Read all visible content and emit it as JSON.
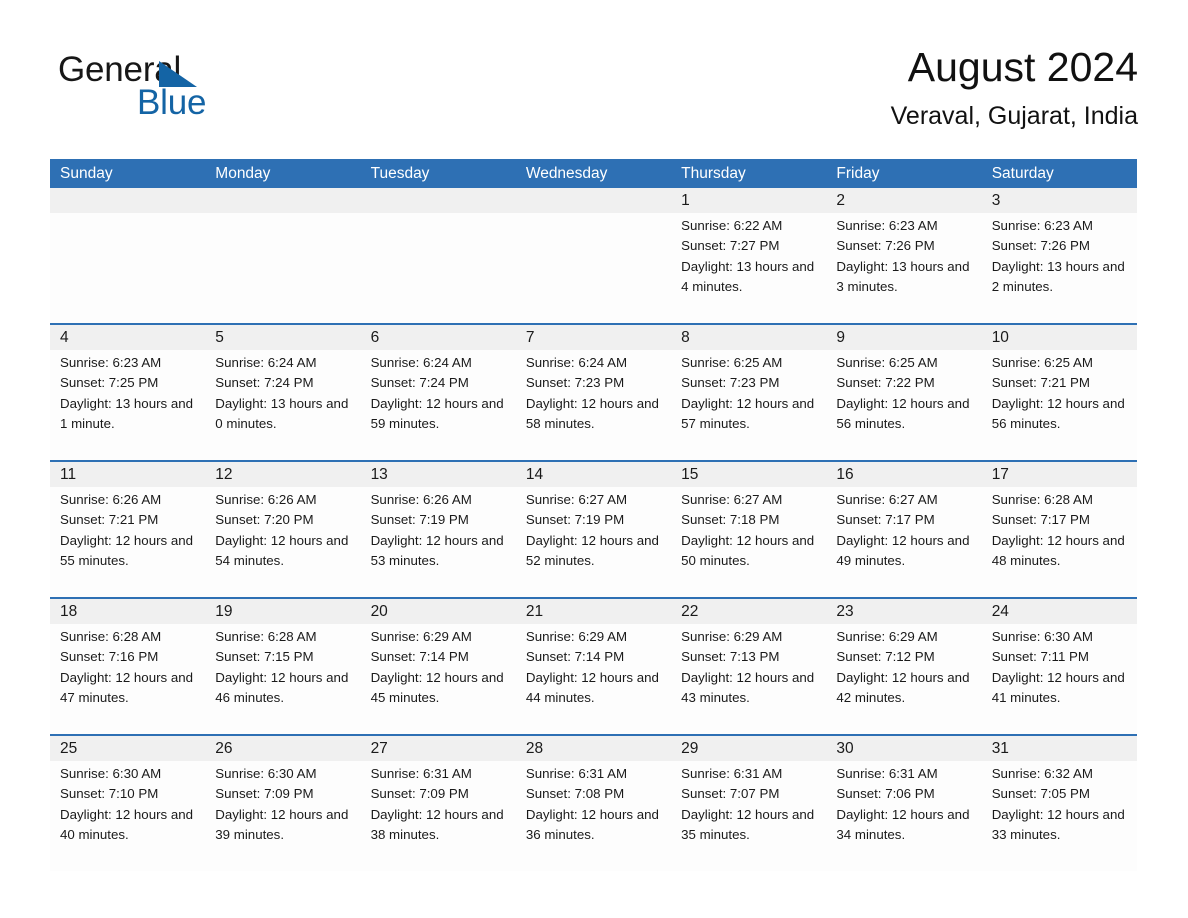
{
  "brand": {
    "name_part1": "General",
    "name_part2": "Blue",
    "accent_color": "#1464a5",
    "triangle_icon": "triangle-icon"
  },
  "header": {
    "title": "August 2024",
    "location": "Veraval, Gujarat, India"
  },
  "theme": {
    "header_blue": "#2e70b4",
    "row_divider_blue": "#2e70b4",
    "day_band_gray": "#f0f0f0",
    "cell_background": "#fdfdfd",
    "text_color": "#1a1a1a"
  },
  "weekdays": [
    "Sunday",
    "Monday",
    "Tuesday",
    "Wednesday",
    "Thursday",
    "Friday",
    "Saturday"
  ],
  "labels": {
    "sunrise_prefix": "Sunrise:",
    "sunset_prefix": "Sunset:",
    "daylight_prefix": "Daylight:"
  },
  "weeks": [
    [
      {
        "day": "",
        "sunrise": "",
        "sunset": "",
        "daylight": "",
        "empty": true
      },
      {
        "day": "",
        "sunrise": "",
        "sunset": "",
        "daylight": "",
        "empty": true
      },
      {
        "day": "",
        "sunrise": "",
        "sunset": "",
        "daylight": "",
        "empty": true
      },
      {
        "day": "",
        "sunrise": "",
        "sunset": "",
        "daylight": "",
        "empty": true
      },
      {
        "day": "1",
        "sunrise": "Sunrise: 6:22 AM",
        "sunset": "Sunset: 7:27 PM",
        "daylight": "Daylight: 13 hours and 4 minutes."
      },
      {
        "day": "2",
        "sunrise": "Sunrise: 6:23 AM",
        "sunset": "Sunset: 7:26 PM",
        "daylight": "Daylight: 13 hours and 3 minutes."
      },
      {
        "day": "3",
        "sunrise": "Sunrise: 6:23 AM",
        "sunset": "Sunset: 7:26 PM",
        "daylight": "Daylight: 13 hours and 2 minutes."
      }
    ],
    [
      {
        "day": "4",
        "sunrise": "Sunrise: 6:23 AM",
        "sunset": "Sunset: 7:25 PM",
        "daylight": "Daylight: 13 hours and 1 minute."
      },
      {
        "day": "5",
        "sunrise": "Sunrise: 6:24 AM",
        "sunset": "Sunset: 7:24 PM",
        "daylight": "Daylight: 13 hours and 0 minutes."
      },
      {
        "day": "6",
        "sunrise": "Sunrise: 6:24 AM",
        "sunset": "Sunset: 7:24 PM",
        "daylight": "Daylight: 12 hours and 59 minutes."
      },
      {
        "day": "7",
        "sunrise": "Sunrise: 6:24 AM",
        "sunset": "Sunset: 7:23 PM",
        "daylight": "Daylight: 12 hours and 58 minutes."
      },
      {
        "day": "8",
        "sunrise": "Sunrise: 6:25 AM",
        "sunset": "Sunset: 7:23 PM",
        "daylight": "Daylight: 12 hours and 57 minutes."
      },
      {
        "day": "9",
        "sunrise": "Sunrise: 6:25 AM",
        "sunset": "Sunset: 7:22 PM",
        "daylight": "Daylight: 12 hours and 56 minutes."
      },
      {
        "day": "10",
        "sunrise": "Sunrise: 6:25 AM",
        "sunset": "Sunset: 7:21 PM",
        "daylight": "Daylight: 12 hours and 56 minutes."
      }
    ],
    [
      {
        "day": "11",
        "sunrise": "Sunrise: 6:26 AM",
        "sunset": "Sunset: 7:21 PM",
        "daylight": "Daylight: 12 hours and 55 minutes."
      },
      {
        "day": "12",
        "sunrise": "Sunrise: 6:26 AM",
        "sunset": "Sunset: 7:20 PM",
        "daylight": "Daylight: 12 hours and 54 minutes."
      },
      {
        "day": "13",
        "sunrise": "Sunrise: 6:26 AM",
        "sunset": "Sunset: 7:19 PM",
        "daylight": "Daylight: 12 hours and 53 minutes."
      },
      {
        "day": "14",
        "sunrise": "Sunrise: 6:27 AM",
        "sunset": "Sunset: 7:19 PM",
        "daylight": "Daylight: 12 hours and 52 minutes."
      },
      {
        "day": "15",
        "sunrise": "Sunrise: 6:27 AM",
        "sunset": "Sunset: 7:18 PM",
        "daylight": "Daylight: 12 hours and 50 minutes."
      },
      {
        "day": "16",
        "sunrise": "Sunrise: 6:27 AM",
        "sunset": "Sunset: 7:17 PM",
        "daylight": "Daylight: 12 hours and 49 minutes."
      },
      {
        "day": "17",
        "sunrise": "Sunrise: 6:28 AM",
        "sunset": "Sunset: 7:17 PM",
        "daylight": "Daylight: 12 hours and 48 minutes."
      }
    ],
    [
      {
        "day": "18",
        "sunrise": "Sunrise: 6:28 AM",
        "sunset": "Sunset: 7:16 PM",
        "daylight": "Daylight: 12 hours and 47 minutes."
      },
      {
        "day": "19",
        "sunrise": "Sunrise: 6:28 AM",
        "sunset": "Sunset: 7:15 PM",
        "daylight": "Daylight: 12 hours and 46 minutes."
      },
      {
        "day": "20",
        "sunrise": "Sunrise: 6:29 AM",
        "sunset": "Sunset: 7:14 PM",
        "daylight": "Daylight: 12 hours and 45 minutes."
      },
      {
        "day": "21",
        "sunrise": "Sunrise: 6:29 AM",
        "sunset": "Sunset: 7:14 PM",
        "daylight": "Daylight: 12 hours and 44 minutes."
      },
      {
        "day": "22",
        "sunrise": "Sunrise: 6:29 AM",
        "sunset": "Sunset: 7:13 PM",
        "daylight": "Daylight: 12 hours and 43 minutes."
      },
      {
        "day": "23",
        "sunrise": "Sunrise: 6:29 AM",
        "sunset": "Sunset: 7:12 PM",
        "daylight": "Daylight: 12 hours and 42 minutes."
      },
      {
        "day": "24",
        "sunrise": "Sunrise: 6:30 AM",
        "sunset": "Sunset: 7:11 PM",
        "daylight": "Daylight: 12 hours and 41 minutes."
      }
    ],
    [
      {
        "day": "25",
        "sunrise": "Sunrise: 6:30 AM",
        "sunset": "Sunset: 7:10 PM",
        "daylight": "Daylight: 12 hours and 40 minutes."
      },
      {
        "day": "26",
        "sunrise": "Sunrise: 6:30 AM",
        "sunset": "Sunset: 7:09 PM",
        "daylight": "Daylight: 12 hours and 39 minutes."
      },
      {
        "day": "27",
        "sunrise": "Sunrise: 6:31 AM",
        "sunset": "Sunset: 7:09 PM",
        "daylight": "Daylight: 12 hours and 38 minutes."
      },
      {
        "day": "28",
        "sunrise": "Sunrise: 6:31 AM",
        "sunset": "Sunset: 7:08 PM",
        "daylight": "Daylight: 12 hours and 36 minutes."
      },
      {
        "day": "29",
        "sunrise": "Sunrise: 6:31 AM",
        "sunset": "Sunset: 7:07 PM",
        "daylight": "Daylight: 12 hours and 35 minutes."
      },
      {
        "day": "30",
        "sunrise": "Sunrise: 6:31 AM",
        "sunset": "Sunset: 7:06 PM",
        "daylight": "Daylight: 12 hours and 34 minutes."
      },
      {
        "day": "31",
        "sunrise": "Sunrise: 6:32 AM",
        "sunset": "Sunset: 7:05 PM",
        "daylight": "Daylight: 12 hours and 33 minutes."
      }
    ]
  ]
}
